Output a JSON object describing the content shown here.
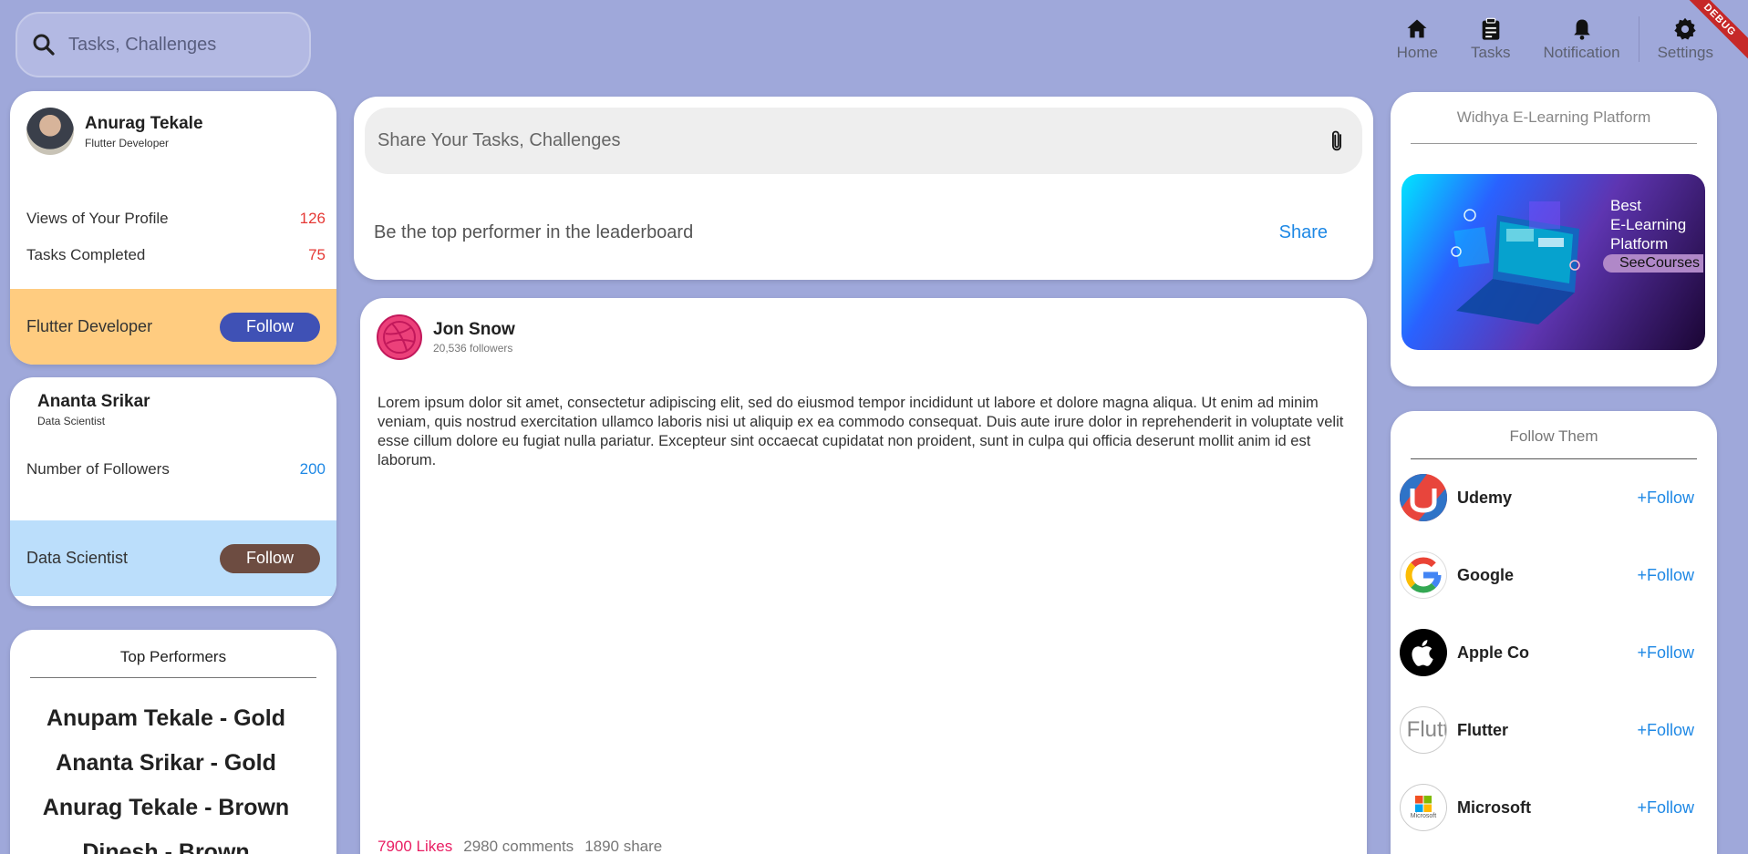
{
  "search": {
    "placeholder": "Tasks, Challenges"
  },
  "nav": {
    "items": [
      {
        "label": "Home",
        "icon": "home-icon"
      },
      {
        "label": "Tasks",
        "icon": "clipboard-icon"
      },
      {
        "label": "Notification",
        "icon": "bell-icon"
      },
      {
        "label": "Settings",
        "icon": "gear-icon"
      }
    ],
    "debug_banner": "DEBUG"
  },
  "profile1": {
    "name": "Anurag Tekale",
    "role": "Flutter Developer",
    "stats": [
      {
        "label": "Views of Your Profile",
        "value": "126"
      },
      {
        "label": "Tasks Completed",
        "value": "75"
      }
    ],
    "band_label": "Flutter Developer",
    "follow_label": "Follow",
    "band_color": "#ffcc80",
    "follow_color": "#3f51b5"
  },
  "profile2": {
    "name": "Ananta Srikar",
    "role": "Data Scientist",
    "stats": [
      {
        "label": "Number of Followers",
        "value": "200"
      }
    ],
    "band_label": "Data Scientist",
    "follow_label": "Follow",
    "band_color": "#bbdefb",
    "follow_color": "#6d4c41"
  },
  "top_performers": {
    "title": "Top Performers",
    "items": [
      "Anupam Tekale - Gold",
      "Ananta Srikar - Gold",
      "Anurag Tekale - Brown",
      "Dinesh - Brown"
    ]
  },
  "share": {
    "placeholder": "Share Your Tasks, Challenges",
    "prompt": "Be the top performer in the leaderboard",
    "button": "Share"
  },
  "post": {
    "author": "Jon Snow",
    "followers": "20,536 followers",
    "body": "Lorem ipsum dolor sit amet, consectetur adipiscing elit, sed do eiusmod tempor incididunt ut labore et dolore magna aliqua. Ut enim ad minim veniam, quis nostrud exercitation ullamco laboris nisi ut aliquip ex ea commodo consequat. Duis aute irure dolor in reprehenderit in voluptate velit esse cillum dolore eu fugiat nulla pariatur. Excepteur sint occaecat cupidatat non proident, sunt in culpa qui officia deserunt mollit anim id est laborum.",
    "likes": "7900 Likes",
    "comments": "2980 comments",
    "shares": "1890 share"
  },
  "ad": {
    "title": "Widhya E-Learning Platform",
    "banner_line1": "Best",
    "banner_line2": "E-Learning",
    "banner_line3": "Platform",
    "cta": "SeeCourses"
  },
  "follow_them": {
    "title": "Follow Them",
    "follow_label": "+Follow",
    "items": [
      {
        "name": "Udemy",
        "icon": "udemy-logo-icon"
      },
      {
        "name": "Google",
        "icon": "google-logo-icon"
      },
      {
        "name": "Apple Co",
        "icon": "apple-logo-icon"
      },
      {
        "name": "Flutter",
        "icon": "flutter-logo-icon",
        "logo_text": "Flutt"
      },
      {
        "name": "Microsoft",
        "icon": "microsoft-logo-icon",
        "logo_text": "Microsoft"
      }
    ]
  }
}
